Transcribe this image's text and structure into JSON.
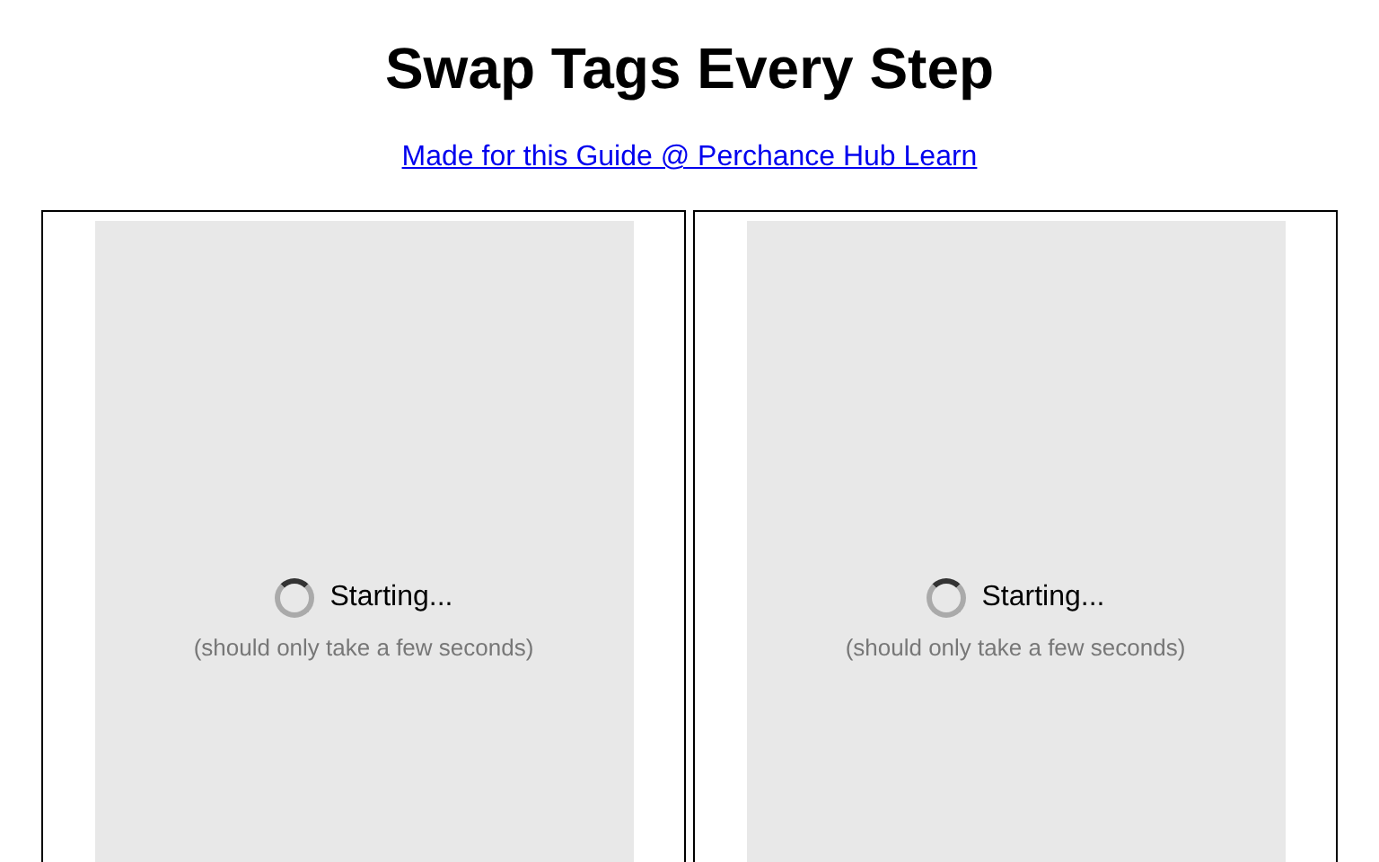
{
  "title": "Swap Tags Every Step",
  "link": "Made for this Guide @ Perchance Hub Learn",
  "panels": [
    {
      "status": "Starting...",
      "note": "(should only take a few seconds)"
    },
    {
      "status": "Starting...",
      "note": "(should only take a few seconds)"
    }
  ]
}
